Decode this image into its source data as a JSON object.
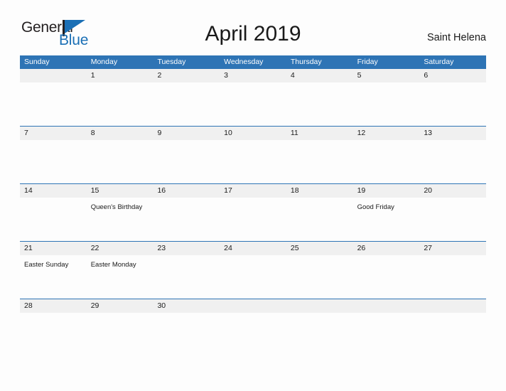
{
  "brand": {
    "word_one": "General",
    "word_two": "Blue",
    "flag_icon": "blue-flag-triangle-icon",
    "accent_color": "#1a6fb5"
  },
  "header": {
    "title": "April 2019",
    "location": "Saint Helena"
  },
  "colors": {
    "header_blue": "#2e74b5",
    "row_gray": "#f0f0f0",
    "text": "#1a1a1a",
    "page_background": "#fdfdfd"
  },
  "calendar": {
    "day_headers": [
      "Sunday",
      "Monday",
      "Tuesday",
      "Wednesday",
      "Thursday",
      "Friday",
      "Saturday"
    ],
    "weeks": [
      {
        "days": [
          {
            "number": "",
            "event": ""
          },
          {
            "number": "1",
            "event": ""
          },
          {
            "number": "2",
            "event": ""
          },
          {
            "number": "3",
            "event": ""
          },
          {
            "number": "4",
            "event": ""
          },
          {
            "number": "5",
            "event": ""
          },
          {
            "number": "6",
            "event": ""
          }
        ]
      },
      {
        "days": [
          {
            "number": "7",
            "event": ""
          },
          {
            "number": "8",
            "event": ""
          },
          {
            "number": "9",
            "event": ""
          },
          {
            "number": "10",
            "event": ""
          },
          {
            "number": "11",
            "event": ""
          },
          {
            "number": "12",
            "event": ""
          },
          {
            "number": "13",
            "event": ""
          }
        ]
      },
      {
        "days": [
          {
            "number": "14",
            "event": ""
          },
          {
            "number": "15",
            "event": "Queen's Birthday"
          },
          {
            "number": "16",
            "event": ""
          },
          {
            "number": "17",
            "event": ""
          },
          {
            "number": "18",
            "event": ""
          },
          {
            "number": "19",
            "event": "Good Friday"
          },
          {
            "number": "20",
            "event": ""
          }
        ]
      },
      {
        "days": [
          {
            "number": "21",
            "event": "Easter Sunday"
          },
          {
            "number": "22",
            "event": "Easter Monday"
          },
          {
            "number": "23",
            "event": ""
          },
          {
            "number": "24",
            "event": ""
          },
          {
            "number": "25",
            "event": ""
          },
          {
            "number": "26",
            "event": ""
          },
          {
            "number": "27",
            "event": ""
          }
        ]
      },
      {
        "days": [
          {
            "number": "28",
            "event": ""
          },
          {
            "number": "29",
            "event": ""
          },
          {
            "number": "30",
            "event": ""
          },
          {
            "number": "",
            "event": ""
          },
          {
            "number": "",
            "event": ""
          },
          {
            "number": "",
            "event": ""
          },
          {
            "number": "",
            "event": ""
          }
        ]
      }
    ]
  }
}
